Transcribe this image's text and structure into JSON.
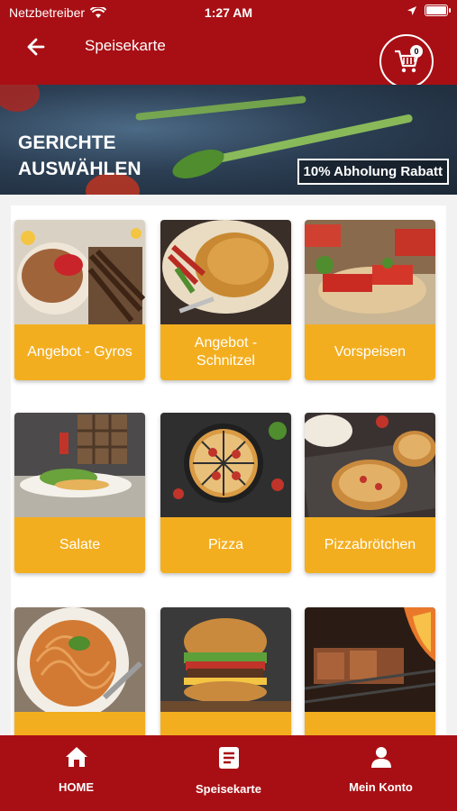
{
  "status": {
    "carrier": "Netzbetreiber",
    "time": "1:27 AM"
  },
  "header": {
    "title": "Speisekarte",
    "cart_count": "0"
  },
  "banner": {
    "heading_line1": "GERICHTE",
    "heading_line2": "AUSWÄHLEN",
    "badge": "10% Abholung Rabatt"
  },
  "categories": [
    {
      "label": "Angebot - Gyros"
    },
    {
      "label": "Angebot - Schnitzel"
    },
    {
      "label": "Vorspeisen"
    },
    {
      "label": "Salate"
    },
    {
      "label": "Pizza"
    },
    {
      "label": "Pizzabrötchen"
    },
    {
      "label": ""
    },
    {
      "label": ""
    },
    {
      "label": ""
    }
  ],
  "nav": {
    "home": "HOME",
    "menu": "Speisekarte",
    "account": "Mein Konto"
  },
  "colors": {
    "brand_red": "#a80f14",
    "card_label": "#f3ae1f"
  }
}
